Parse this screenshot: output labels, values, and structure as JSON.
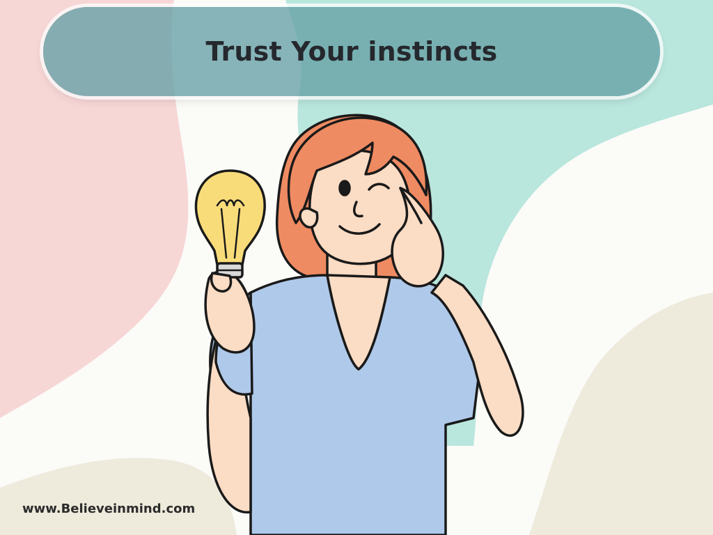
{
  "banner": {
    "title": "Trust Your instincts"
  },
  "footer": {
    "watermark": "www.Believeinmind.com"
  },
  "illustration": {
    "subject": "woman-winking-pointing-at-head-holding-lightbulb"
  },
  "colors": {
    "banner": "#65a0a5",
    "pink_blob": "#f7d6d6",
    "mint_blob": "#b9e6dd",
    "beige_blob": "#eeeadc",
    "hair": "#ef8b62",
    "skin": "#fbdcc4",
    "shirt": "#afc9ea",
    "bulb": "#f9dc7a",
    "outline": "#1a1a1a"
  }
}
